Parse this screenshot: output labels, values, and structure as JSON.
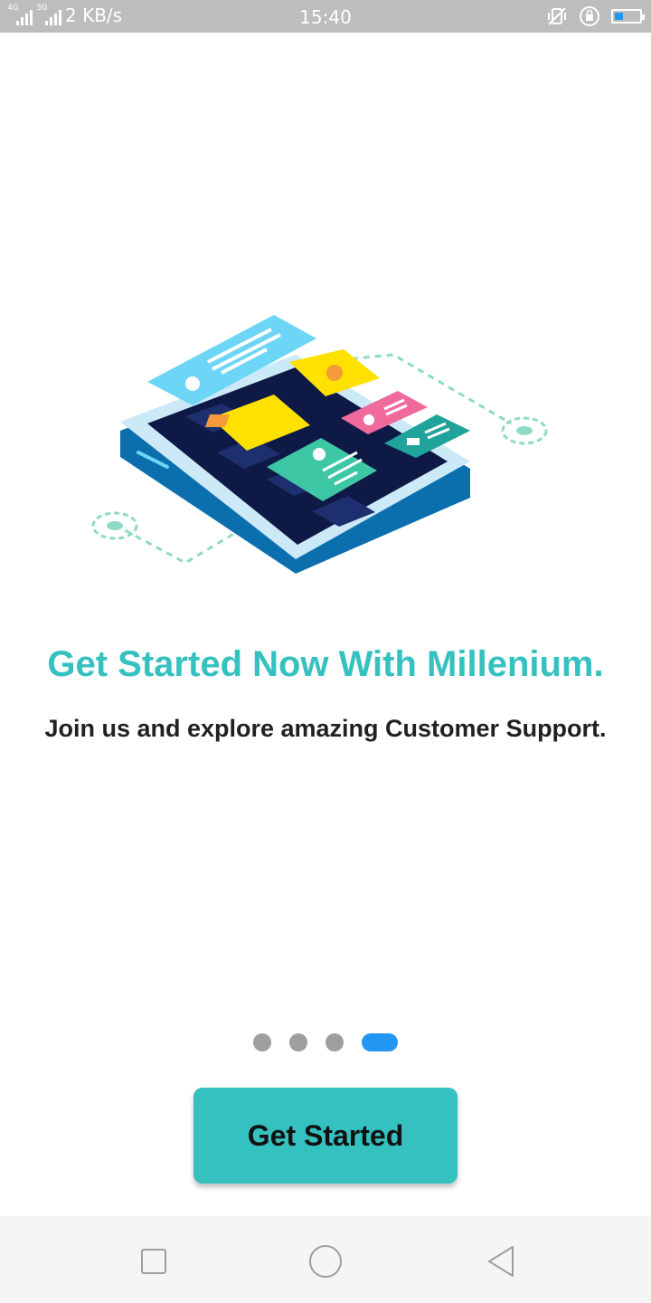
{
  "status_bar": {
    "signal_1_tag": "4G",
    "signal_2_tag": "3G",
    "speed": "2 KB/s",
    "time": "15:40",
    "icons": [
      "vibrate-off-icon",
      "rotation-lock-icon",
      "battery-icon"
    ],
    "battery_level": 0.25
  },
  "hero": {
    "illustration": "mobile-app-isometric-illustration",
    "colors": {
      "phone": "#0b6fae",
      "screen": "#0e1a45",
      "card_blue": "#6dd5f5",
      "card_yellow": "#ffe100",
      "card_pink": "#f06a9c",
      "card_teal": "#3dc7a4",
      "card_dark_teal": "#1fa39a"
    }
  },
  "onboarding": {
    "title": "Get Started Now With Millenium.",
    "subtitle": "Join us and explore amazing Customer Support.",
    "pages": 4,
    "current_page": 4
  },
  "cta": {
    "label": "Get Started"
  },
  "nav_bar": {
    "buttons": [
      "recent-apps-icon",
      "home-icon",
      "back-icon"
    ]
  },
  "colors": {
    "accent": "#35c1c0",
    "indicator_active": "#2196f3",
    "indicator_inactive": "#9e9e9e",
    "text": "#212121"
  }
}
